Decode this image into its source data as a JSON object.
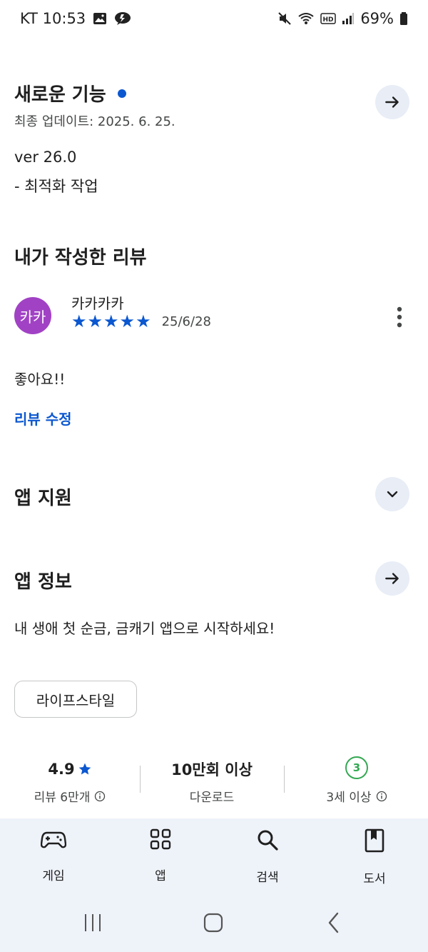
{
  "status": {
    "carrier_time": "KT 10:53",
    "battery": "69%"
  },
  "whats_new": {
    "title": "새로운 기능",
    "updated": "최종 업데이트: 2025. 6. 25.",
    "version": "ver 26.0",
    "note": "- 최적화 작업"
  },
  "my_review": {
    "title": "내가 작성한 리뷰",
    "avatar_text": "카카",
    "user": "카카카카",
    "rating": 5,
    "stars": "★★★★★",
    "date": "25/6/28",
    "text": "좋아요!!",
    "edit_label": "리뷰 수정"
  },
  "app_support": {
    "title": "앱 지원"
  },
  "app_info": {
    "title": "앱 정보",
    "description": "내 생애 첫 순금, 금캐기 앱으로 시작하세요!",
    "category": "라이프스타일"
  },
  "stats": {
    "rating": "4.9",
    "rating_label": "리뷰 6만개",
    "downloads": "10만회 이상",
    "downloads_label": "다운로드",
    "age_badge": "3",
    "age_label": "3세 이상"
  },
  "nav": {
    "games": "게임",
    "apps": "앱",
    "search": "검색",
    "books": "도서"
  },
  "colors": {
    "accent": "#0b57d0",
    "avatar": "#a142c5",
    "age_badge": "#34a853"
  }
}
